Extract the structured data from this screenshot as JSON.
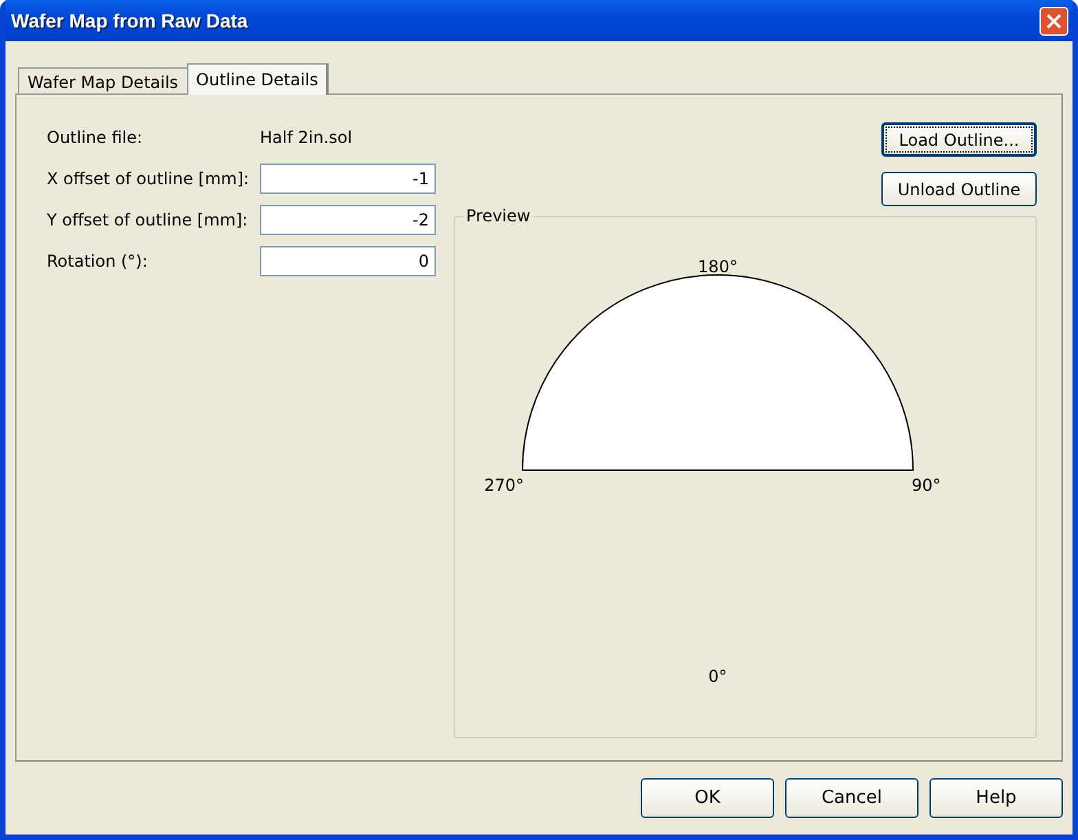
{
  "window": {
    "title": "Wafer Map from Raw Data"
  },
  "tabs": [
    {
      "label": "Wafer Map Details",
      "selected": false
    },
    {
      "label": "Outline Details",
      "selected": true
    }
  ],
  "outline_file": {
    "label": "Outline file:",
    "value": "Half 2in.sol"
  },
  "fields": [
    {
      "label": "X offset of outline [mm]:",
      "value": "-1"
    },
    {
      "label": "Y offset of outline [mm]:",
      "value": "-2"
    },
    {
      "label": "Rotation (°):",
      "value": "0"
    }
  ],
  "side_buttons": [
    {
      "label": "Load Outline...",
      "focused": true
    },
    {
      "label": "Unload Outline",
      "focused": false
    }
  ],
  "preview": {
    "title": "Preview",
    "labels": {
      "top": "180°",
      "left": "270°",
      "right": "90°",
      "bottom": "0°"
    }
  },
  "buttons": [
    "OK",
    "Cancel",
    "Help"
  ]
}
